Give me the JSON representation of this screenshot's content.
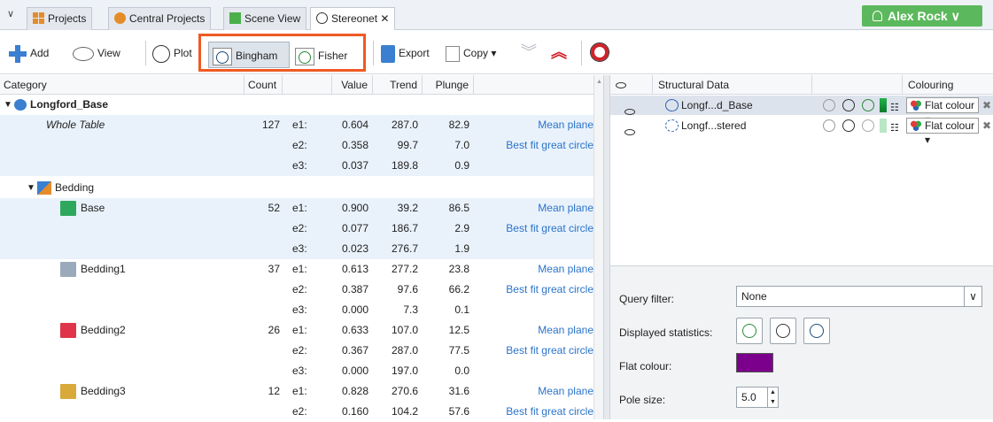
{
  "tabs": [
    {
      "label": "Projects",
      "icon": "projects-icon"
    },
    {
      "label": "Central Projects",
      "icon": "central-projects-icon"
    },
    {
      "label": "Scene View",
      "icon": "scene-view-icon"
    },
    {
      "label": "Stereonet ✕",
      "icon": "stereonet-icon"
    }
  ],
  "user": {
    "name": "Alex Rock ∨"
  },
  "toolbar": {
    "add": "Add",
    "view": "View",
    "plot": "Plot",
    "bingham": "Bingham",
    "fisher": "Fisher",
    "export": "Export",
    "copy": "Copy ▾"
  },
  "table": {
    "headers": {
      "category": "Category",
      "count": "Count",
      "value": "Value",
      "trend": "Trend",
      "plunge": "Plunge"
    },
    "root": "Longford_Base",
    "whole_table": {
      "name": "Whole Table",
      "count": "127",
      "rows": [
        {
          "e": "e1:",
          "value": "0.604",
          "trend": "287.0",
          "plunge": "82.9",
          "desc": "Mean plane"
        },
        {
          "e": "e2:",
          "value": "0.358",
          "trend": "99.7",
          "plunge": "7.0",
          "desc": "Best fit great circle"
        },
        {
          "e": "e3:",
          "value": "0.037",
          "trend": "189.8",
          "plunge": "0.9",
          "desc": ""
        }
      ]
    },
    "bedding_label": "Bedding",
    "groups": [
      {
        "name": "Base",
        "count": "52",
        "color": "#2ea85c",
        "rows": [
          {
            "e": "e1:",
            "value": "0.900",
            "trend": "39.2",
            "plunge": "86.5",
            "desc": "Mean plane"
          },
          {
            "e": "e2:",
            "value": "0.077",
            "trend": "186.7",
            "plunge": "2.9",
            "desc": "Best fit great circle"
          },
          {
            "e": "e3:",
            "value": "0.023",
            "trend": "276.7",
            "plunge": "1.9",
            "desc": ""
          }
        ]
      },
      {
        "name": "Bedding1",
        "count": "37",
        "color": "#9aaabb",
        "rows": [
          {
            "e": "e1:",
            "value": "0.613",
            "trend": "277.2",
            "plunge": "23.8",
            "desc": "Mean plane"
          },
          {
            "e": "e2:",
            "value": "0.387",
            "trend": "97.6",
            "plunge": "66.2",
            "desc": "Best fit great circle"
          },
          {
            "e": "e3:",
            "value": "0.000",
            "trend": "7.3",
            "plunge": "0.1",
            "desc": ""
          }
        ]
      },
      {
        "name": "Bedding2",
        "count": "26",
        "color": "#e0344a",
        "rows": [
          {
            "e": "e1:",
            "value": "0.633",
            "trend": "107.0",
            "plunge": "12.5",
            "desc": "Mean plane"
          },
          {
            "e": "e2:",
            "value": "0.367",
            "trend": "287.0",
            "plunge": "77.5",
            "desc": "Best fit great circle"
          },
          {
            "e": "e3:",
            "value": "0.000",
            "trend": "197.0",
            "plunge": "0.0",
            "desc": ""
          }
        ]
      },
      {
        "name": "Bedding3",
        "count": "12",
        "color": "#d9aa3a",
        "rows": [
          {
            "e": "e1:",
            "value": "0.828",
            "trend": "270.6",
            "plunge": "31.6",
            "desc": "Mean plane"
          },
          {
            "e": "e2:",
            "value": "0.160",
            "trend": "104.2",
            "plunge": "57.6",
            "desc": "Best fit great circle"
          }
        ]
      }
    ]
  },
  "right_panel": {
    "headers": {
      "structural": "Structural Data",
      "colouring": "Colouring"
    },
    "rows": [
      {
        "name": "Longf...d_Base",
        "colouring": "Flat colour"
      },
      {
        "name": "Longf...stered",
        "colouring": "Flat colour"
      }
    ],
    "query_filter_label": "Query filter:",
    "query_filter_value": "None",
    "displayed_stats_label": "Displayed statistics:",
    "flat_colour_label": "Flat colour:",
    "flat_colour": "#7b008c",
    "pole_size_label": "Pole size:",
    "pole_size": "5.0"
  }
}
